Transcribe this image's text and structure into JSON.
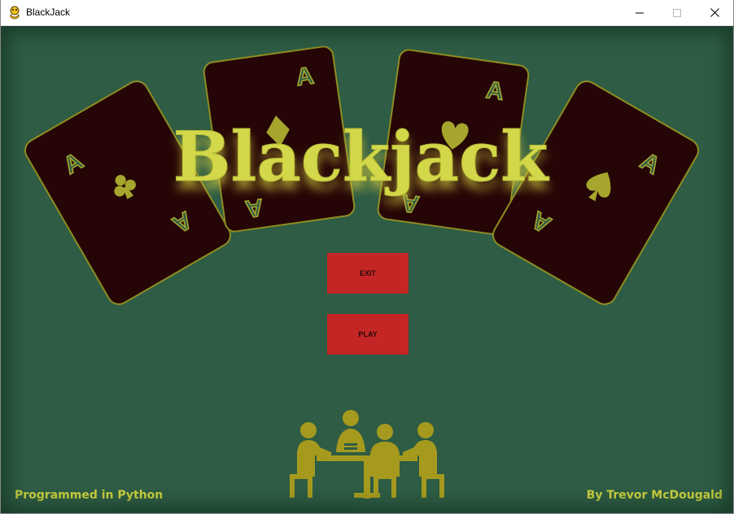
{
  "window": {
    "title": "BlackJack",
    "icon": "python-snake-icon",
    "controls": [
      "minimize-icon",
      "maximize-icon",
      "close-icon"
    ]
  },
  "game": {
    "logo_text": "Blackjack",
    "cards": [
      {
        "rank": "A",
        "suit": "club"
      },
      {
        "rank": "A",
        "suit": "diamond"
      },
      {
        "rank": "A",
        "suit": "heart"
      },
      {
        "rank": "A",
        "suit": "spade"
      }
    ],
    "buttons": {
      "exit": "EXIT",
      "play": "PLAY"
    },
    "footer": {
      "left": "Programmed in Python",
      "right": "By Trevor McDougald"
    }
  },
  "colors": {
    "table_felt": "#2e5c44",
    "card_face": "#250506",
    "card_ink": "#a6a62e",
    "logo": "#d2d84a",
    "button": "#c42626",
    "footer_text": "#c9cf3e",
    "players": "#a69a1e"
  }
}
